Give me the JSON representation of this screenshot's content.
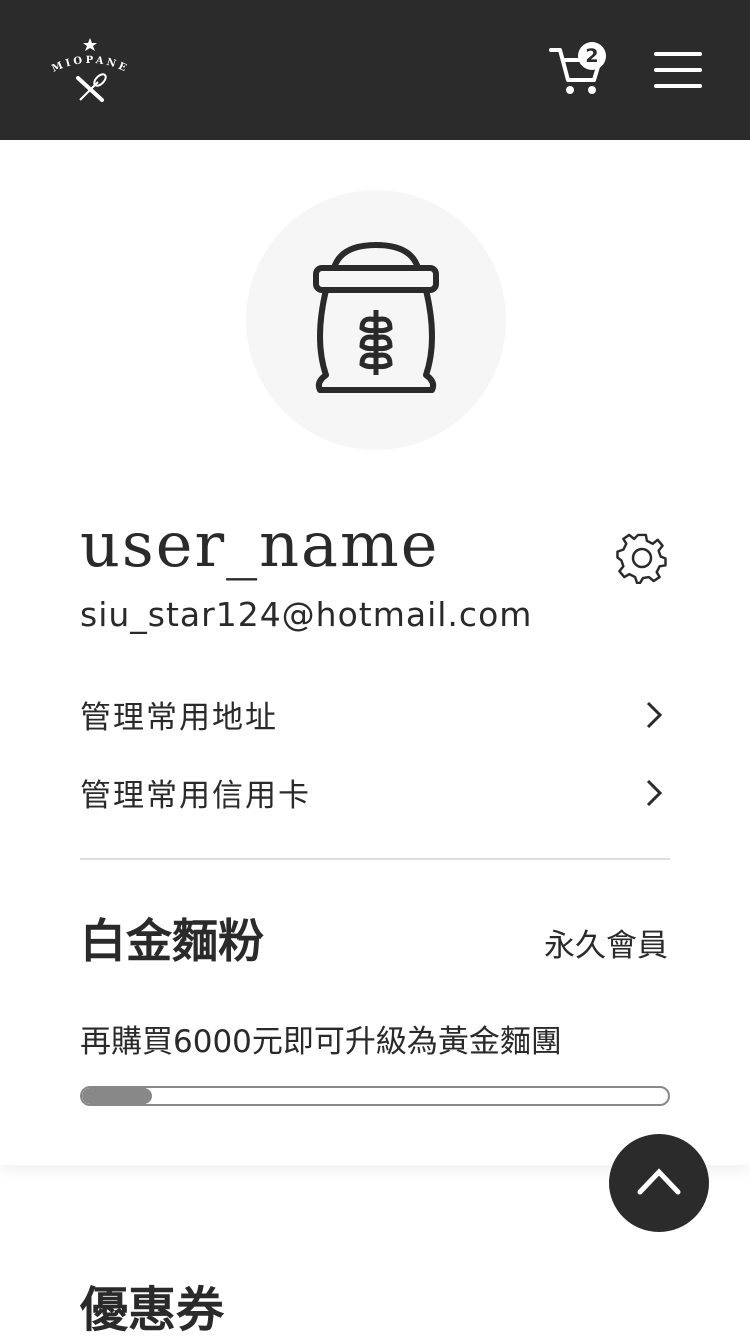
{
  "header": {
    "brand": "MIOPANE",
    "cart_count": "2"
  },
  "profile": {
    "username": "user_name",
    "email": "siu_star124@hotmail.com"
  },
  "links": [
    {
      "label": "管理常用地址"
    },
    {
      "label": "管理常用信用卡"
    }
  ],
  "membership": {
    "tier": "白金麵粉",
    "type": "永久會員",
    "upgrade_text": "再購買6000元即可升級為黃金麵團",
    "progress_percent": 12
  },
  "coupons": {
    "title": "優惠券"
  },
  "colors": {
    "header_bg": "#2b2b2b",
    "progress": "#888888"
  }
}
